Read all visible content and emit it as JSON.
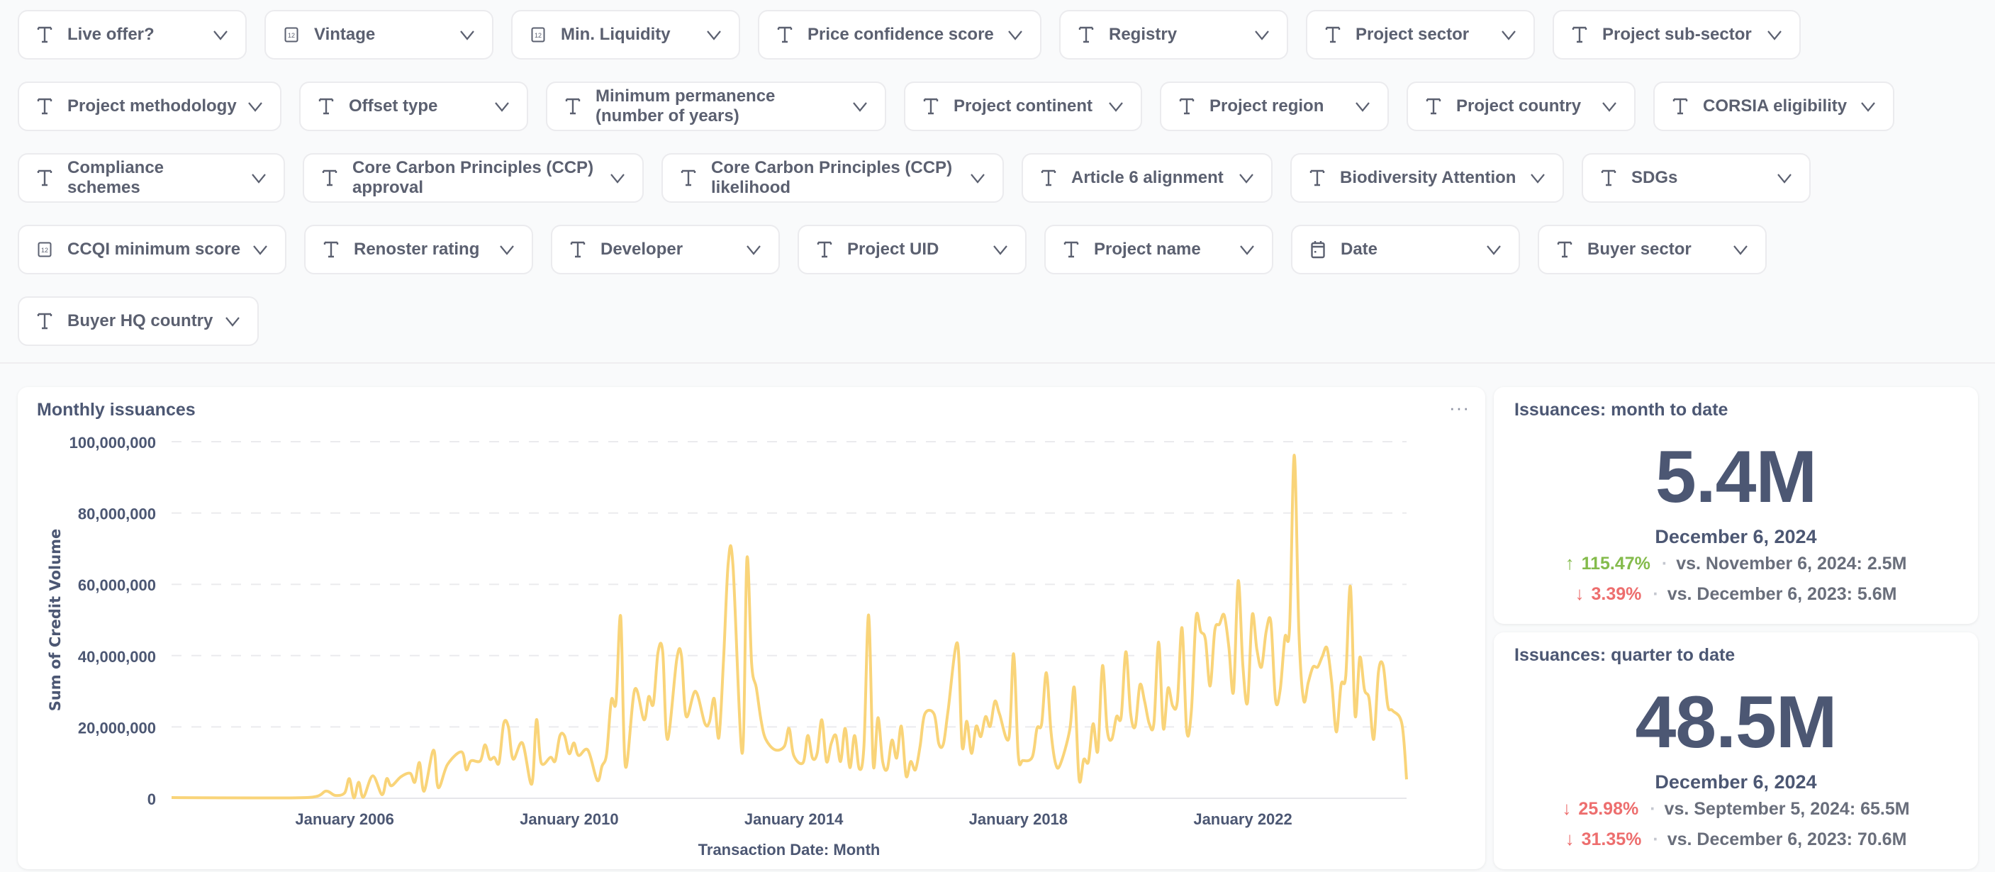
{
  "filters": [
    {
      "label": "Live offer?",
      "icon": "text-type-icon"
    },
    {
      "label": "Vintage",
      "icon": "number-icon"
    },
    {
      "label": "Min. Liquidity",
      "icon": "number-icon"
    },
    {
      "label": "Price confidence score",
      "icon": "text-type-icon"
    },
    {
      "label": "Registry",
      "icon": "text-type-icon"
    },
    {
      "label": "Project sector",
      "icon": "text-type-icon"
    },
    {
      "label": "Project sub-sector",
      "icon": "text-type-icon"
    },
    {
      "label": "Project methodology",
      "icon": "text-type-icon"
    },
    {
      "label": "Offset type",
      "icon": "text-type-icon"
    },
    {
      "label": "Minimum permanence (number of years)",
      "icon": "text-type-icon"
    },
    {
      "label": "Project continent",
      "icon": "text-type-icon"
    },
    {
      "label": "Project region",
      "icon": "text-type-icon"
    },
    {
      "label": "Project country",
      "icon": "text-type-icon"
    },
    {
      "label": "CORSIA eligibility",
      "icon": "text-type-icon"
    },
    {
      "label": "Compliance schemes",
      "icon": "text-type-icon"
    },
    {
      "label": "Core Carbon Principles (CCP) approval",
      "icon": "text-type-icon"
    },
    {
      "label": "Core Carbon Principles (CCP) likelihood",
      "icon": "text-type-icon"
    },
    {
      "label": "Article 6 alignment",
      "icon": "text-type-icon"
    },
    {
      "label": "Biodiversity Attention",
      "icon": "text-type-icon"
    },
    {
      "label": "SDGs",
      "icon": "text-type-icon"
    },
    {
      "label": "CCQI minimum score",
      "icon": "number-icon"
    },
    {
      "label": "Renoster rating",
      "icon": "text-type-icon"
    },
    {
      "label": "Developer",
      "icon": "text-type-icon"
    },
    {
      "label": "Project UID",
      "icon": "text-type-icon"
    },
    {
      "label": "Project name",
      "icon": "text-type-icon"
    },
    {
      "label": "Date",
      "icon": "calendar-icon"
    },
    {
      "label": "Buyer sector",
      "icon": "text-type-icon"
    },
    {
      "label": "Buyer HQ country",
      "icon": "text-type-icon"
    }
  ],
  "chart_card": {
    "title": "Monthly issuances",
    "menu": "···"
  },
  "chart_data": {
    "type": "line",
    "title": "Monthly issuances",
    "xlabel": "Transaction Date: Month",
    "ylabel": "Sum of Credit Volume",
    "ylim": [
      0,
      100000000
    ],
    "xlim": [
      "2002-12",
      "2024-12"
    ],
    "yticks": [
      "0",
      "20,000,000",
      "40,000,000",
      "60,000,000",
      "80,000,000",
      "100,000,000"
    ],
    "ytick_values": [
      0,
      20000000,
      40000000,
      60000000,
      80000000,
      100000000
    ],
    "xticks": [
      {
        "label": "January 2006",
        "date": "2006-01"
      },
      {
        "label": "January 2010",
        "date": "2010-01"
      },
      {
        "label": "January 2014",
        "date": "2014-01"
      },
      {
        "label": "January 2018",
        "date": "2018-01"
      },
      {
        "label": "January 2022",
        "date": "2022-01"
      }
    ],
    "grid": "horizontal dashed",
    "color": "#f9d479",
    "points": [
      [
        "2002-12",
        200000
      ],
      [
        "2004-06",
        100000
      ],
      [
        "2005-06",
        300000
      ],
      [
        "2005-09",
        2000000
      ],
      [
        "2005-11",
        800000
      ],
      [
        "2006-01",
        1500000
      ],
      [
        "2006-02",
        5500000
      ],
      [
        "2006-03",
        100000
      ],
      [
        "2006-04",
        4500000
      ],
      [
        "2006-05",
        300000
      ],
      [
        "2006-07",
        6300000
      ],
      [
        "2006-09",
        1000000
      ],
      [
        "2006-10",
        5500000
      ],
      [
        "2006-11",
        3500000
      ],
      [
        "2007-01",
        6000000
      ],
      [
        "2007-03",
        7000000
      ],
      [
        "2007-04",
        4500000
      ],
      [
        "2007-05",
        10000000
      ],
      [
        "2007-06",
        2000000
      ],
      [
        "2007-08",
        13500000
      ],
      [
        "2007-09",
        3000000
      ],
      [
        "2007-11",
        9500000
      ],
      [
        "2008-02",
        13000000
      ],
      [
        "2008-03",
        8000000
      ],
      [
        "2008-04",
        10500000
      ],
      [
        "2008-06",
        10500000
      ],
      [
        "2008-07",
        15000000
      ],
      [
        "2008-08",
        11000000
      ],
      [
        "2008-09",
        11500000
      ],
      [
        "2008-10",
        10000000
      ],
      [
        "2008-11",
        21000000
      ],
      [
        "2008-12",
        20000000
      ],
      [
        "2009-01",
        11000000
      ],
      [
        "2009-03",
        15500000
      ],
      [
        "2009-05",
        4000000
      ],
      [
        "2009-06",
        22000000
      ],
      [
        "2009-07",
        10000000
      ],
      [
        "2009-09",
        11500000
      ],
      [
        "2009-10",
        10500000
      ],
      [
        "2009-11",
        17500000
      ],
      [
        "2009-12",
        17500000
      ],
      [
        "2010-01",
        12500000
      ],
      [
        "2010-02",
        15500000
      ],
      [
        "2010-03",
        12000000
      ],
      [
        "2010-05",
        13500000
      ],
      [
        "2010-07",
        5000000
      ],
      [
        "2010-08",
        9000000
      ],
      [
        "2010-09",
        12500000
      ],
      [
        "2010-10",
        27500000
      ],
      [
        "2010-11",
        27000000
      ],
      [
        "2010-12",
        51000000
      ],
      [
        "2011-01",
        9000000
      ],
      [
        "2011-03",
        30500000
      ],
      [
        "2011-05",
        22000000
      ],
      [
        "2011-06",
        28500000
      ],
      [
        "2011-07",
        26500000
      ],
      [
        "2011-08",
        41000000
      ],
      [
        "2011-09",
        41000000
      ],
      [
        "2011-10",
        16500000
      ],
      [
        "2011-12",
        39000000
      ],
      [
        "2012-01",
        40000000
      ],
      [
        "2012-02",
        23000000
      ],
      [
        "2012-04",
        30000000
      ],
      [
        "2012-06",
        21000000
      ],
      [
        "2012-07",
        21500000
      ],
      [
        "2012-08",
        28000000
      ],
      [
        "2012-09",
        17000000
      ],
      [
        "2012-10",
        39000000
      ],
      [
        "2012-11",
        66000000
      ],
      [
        "2012-12",
        65500000
      ],
      [
        "2013-02",
        12600000
      ],
      [
        "2013-03",
        67300000
      ],
      [
        "2013-04",
        37800000
      ],
      [
        "2013-05",
        31000000
      ],
      [
        "2013-06",
        22000000
      ],
      [
        "2013-07",
        16600000
      ],
      [
        "2013-09",
        13600000
      ],
      [
        "2013-11",
        14600000
      ],
      [
        "2013-12",
        19600000
      ],
      [
        "2014-01",
        12000000
      ],
      [
        "2014-03",
        10000000
      ],
      [
        "2014-04",
        17600000
      ],
      [
        "2014-05",
        11300000
      ],
      [
        "2014-06",
        12600000
      ],
      [
        "2014-07",
        22000000
      ],
      [
        "2014-08",
        10300000
      ],
      [
        "2014-09",
        15300000
      ],
      [
        "2014-10",
        17600000
      ],
      [
        "2014-11",
        10300000
      ],
      [
        "2014-12",
        19600000
      ],
      [
        "2015-01",
        8600000
      ],
      [
        "2015-02",
        17600000
      ],
      [
        "2015-03",
        8300000
      ],
      [
        "2015-04",
        14600000
      ],
      [
        "2015-05",
        51400000
      ],
      [
        "2015-06",
        9300000
      ],
      [
        "2015-07",
        22600000
      ],
      [
        "2015-08",
        10300000
      ],
      [
        "2015-09",
        8300000
      ],
      [
        "2015-10",
        16300000
      ],
      [
        "2015-11",
        11300000
      ],
      [
        "2015-12",
        20200000
      ],
      [
        "2016-01",
        6300000
      ],
      [
        "2016-02",
        10300000
      ],
      [
        "2016-03",
        8000000
      ],
      [
        "2016-04",
        14600000
      ],
      [
        "2016-05",
        23600000
      ],
      [
        "2016-07",
        23600000
      ],
      [
        "2016-08",
        15300000
      ],
      [
        "2016-09",
        15300000
      ],
      [
        "2016-10",
        24600000
      ],
      [
        "2016-12",
        43500000
      ],
      [
        "2017-01",
        14600000
      ],
      [
        "2017-02",
        21600000
      ],
      [
        "2017-03",
        12600000
      ],
      [
        "2017-04",
        20200000
      ],
      [
        "2017-05",
        17300000
      ],
      [
        "2017-06",
        22900000
      ],
      [
        "2017-07",
        20200000
      ],
      [
        "2017-08",
        27200000
      ],
      [
        "2017-09",
        23600000
      ],
      [
        "2017-11",
        16900000
      ],
      [
        "2017-12",
        40500000
      ],
      [
        "2018-01",
        12000000
      ],
      [
        "2018-02",
        10600000
      ],
      [
        "2018-04",
        11600000
      ],
      [
        "2018-05",
        19600000
      ],
      [
        "2018-06",
        20900000
      ],
      [
        "2018-07",
        35200000
      ],
      [
        "2018-08",
        18600000
      ],
      [
        "2018-09",
        9600000
      ],
      [
        "2018-10",
        9600000
      ],
      [
        "2018-12",
        19200000
      ],
      [
        "2019-01",
        30900000
      ],
      [
        "2019-02",
        5300000
      ],
      [
        "2019-03",
        10900000
      ],
      [
        "2019-04",
        10300000
      ],
      [
        "2019-05",
        20900000
      ],
      [
        "2019-06",
        13300000
      ],
      [
        "2019-07",
        37200000
      ],
      [
        "2019-08",
        19200000
      ],
      [
        "2019-09",
        16600000
      ],
      [
        "2019-10",
        22900000
      ],
      [
        "2019-11",
        22900000
      ],
      [
        "2019-12",
        41100000
      ],
      [
        "2020-01",
        23900000
      ],
      [
        "2020-02",
        20200000
      ],
      [
        "2020-03",
        31800000
      ],
      [
        "2020-04",
        27200000
      ],
      [
        "2020-05",
        20900000
      ],
      [
        "2020-06",
        21200000
      ],
      [
        "2020-07",
        43800000
      ],
      [
        "2020-08",
        19600000
      ],
      [
        "2020-09",
        30900000
      ],
      [
        "2020-10",
        25900000
      ],
      [
        "2020-11",
        27200000
      ],
      [
        "2020-12",
        47800000
      ],
      [
        "2021-01",
        18900000
      ],
      [
        "2021-02",
        24600000
      ],
      [
        "2021-03",
        50800000
      ],
      [
        "2021-04",
        46800000
      ],
      [
        "2021-05",
        44500000
      ],
      [
        "2021-06",
        31500000
      ],
      [
        "2021-07",
        47100000
      ],
      [
        "2021-08",
        48800000
      ],
      [
        "2021-09",
        51400000
      ],
      [
        "2021-10",
        42500000
      ],
      [
        "2021-11",
        29900000
      ],
      [
        "2021-12",
        61000000
      ],
      [
        "2022-01",
        37200000
      ],
      [
        "2022-02",
        26900000
      ],
      [
        "2022-03",
        51400000
      ],
      [
        "2022-04",
        41800000
      ],
      [
        "2022-05",
        36800000
      ],
      [
        "2022-06",
        46800000
      ],
      [
        "2022-07",
        49400000
      ],
      [
        "2022-08",
        27500000
      ],
      [
        "2022-09",
        30500000
      ],
      [
        "2022-10",
        45100000
      ],
      [
        "2022-11",
        47800000
      ],
      [
        "2022-12",
        96200000
      ],
      [
        "2023-01",
        46500000
      ],
      [
        "2023-02",
        27500000
      ],
      [
        "2023-03",
        32500000
      ],
      [
        "2023-04",
        36800000
      ],
      [
        "2023-05",
        36800000
      ],
      [
        "2023-06",
        39800000
      ],
      [
        "2023-07",
        42100000
      ],
      [
        "2023-08",
        32500000
      ],
      [
        "2023-09",
        18600000
      ],
      [
        "2023-10",
        31800000
      ],
      [
        "2023-11",
        34200000
      ],
      [
        "2023-12",
        59400000
      ],
      [
        "2024-01",
        23200000
      ],
      [
        "2024-02",
        39500000
      ],
      [
        "2024-03",
        30500000
      ],
      [
        "2024-04",
        27900000
      ],
      [
        "2024-05",
        16600000
      ],
      [
        "2024-06",
        35500000
      ],
      [
        "2024-07",
        37200000
      ],
      [
        "2024-08",
        25900000
      ],
      [
        "2024-09",
        24600000
      ],
      [
        "2024-11",
        20900000
      ],
      [
        "2024-12",
        5300000
      ]
    ]
  },
  "kpis": [
    {
      "title": "Issuances: month to date",
      "value": "5.4M",
      "date": "December 6, 2024",
      "comparisons": [
        {
          "direction": "up",
          "arrow": "↑",
          "percent": "115.47%",
          "separator": "·",
          "text": "vs. November 6, 2024: 2.5M"
        },
        {
          "direction": "down",
          "arrow": "↓",
          "percent": "3.39%",
          "separator": "·",
          "text": "vs. December 6, 2023: 5.6M"
        }
      ]
    },
    {
      "title": "Issuances: quarter to date",
      "value": "48.5M",
      "date": "December 6, 2024",
      "comparisons": [
        {
          "direction": "down",
          "arrow": "↓",
          "percent": "25.98%",
          "separator": "·",
          "text": "vs. September 5, 2024: 65.5M"
        },
        {
          "direction": "down",
          "arrow": "↓",
          "percent": "31.35%",
          "separator": "·",
          "text": "vs. December 6, 2023: 70.6M"
        }
      ]
    }
  ],
  "colors": {
    "text": "#4c5773",
    "line": "#f9d479",
    "up": "#84bb4c",
    "down": "#ed6e6e",
    "background": "#f9fafb"
  }
}
